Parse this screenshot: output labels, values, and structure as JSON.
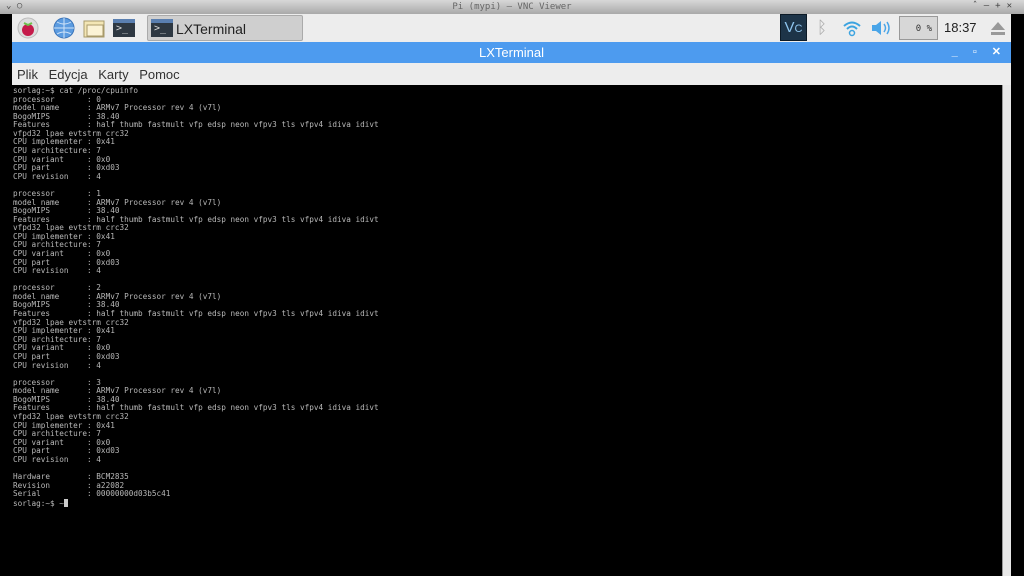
{
  "vnc_title": "Pi (mypi) — VNC Viewer",
  "panel": {
    "task_label": "LXTerminal",
    "cpu": "0 %",
    "clock": "18:37"
  },
  "window": {
    "title": "LXTerminal"
  },
  "menu": [
    "Plik",
    "Edycja",
    "Karty",
    "Pomoc"
  ],
  "terminal": {
    "lines": [
      "sorlag:~$ cat /proc/cpuinfo",
      "processor       : 0",
      "model name      : ARMv7 Processor rev 4 (v7l)",
      "BogoMIPS        : 38.40",
      "Features        : half thumb fastmult vfp edsp neon vfpv3 tls vfpv4 idiva idivt",
      "vfpd32 lpae evtstrm crc32",
      "CPU implementer : 0x41",
      "CPU architecture: 7",
      "CPU variant     : 0x0",
      "CPU part        : 0xd03",
      "CPU revision    : 4",
      "",
      "processor       : 1",
      "model name      : ARMv7 Processor rev 4 (v7l)",
      "BogoMIPS        : 38.40",
      "Features        : half thumb fastmult vfp edsp neon vfpv3 tls vfpv4 idiva idivt",
      "vfpd32 lpae evtstrm crc32",
      "CPU implementer : 0x41",
      "CPU architecture: 7",
      "CPU variant     : 0x0",
      "CPU part        : 0xd03",
      "CPU revision    : 4",
      "",
      "processor       : 2",
      "model name      : ARMv7 Processor rev 4 (v7l)",
      "BogoMIPS        : 38.40",
      "Features        : half thumb fastmult vfp edsp neon vfpv3 tls vfpv4 idiva idivt",
      "vfpd32 lpae evtstrm crc32",
      "CPU implementer : 0x41",
      "CPU architecture: 7",
      "CPU variant     : 0x0",
      "CPU part        : 0xd03",
      "CPU revision    : 4",
      "",
      "processor       : 3",
      "model name      : ARMv7 Processor rev 4 (v7l)",
      "BogoMIPS        : 38.40",
      "Features        : half thumb fastmult vfp edsp neon vfpv3 tls vfpv4 idiva idivt",
      "vfpd32 lpae evtstrm crc32",
      "CPU implementer : 0x41",
      "CPU architecture: 7",
      "CPU variant     : 0x0",
      "CPU part        : 0xd03",
      "CPU revision    : 4",
      "",
      "Hardware        : BCM2835",
      "Revision        : a22082",
      "Serial          : 00000000d03b5c41"
    ],
    "prompt": "sorlag:~$ ~"
  }
}
